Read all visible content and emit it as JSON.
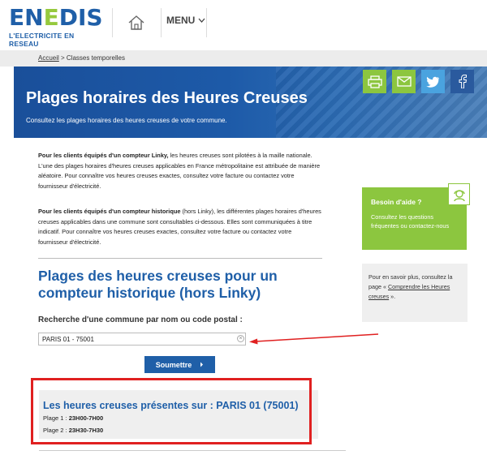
{
  "header": {
    "logo_word_a": "EN",
    "logo_word_b": "E",
    "logo_word_c": "DIS",
    "logo_tagline": "L'ELECTRICITE EN RESEAU",
    "menu_label": "MENU"
  },
  "breadcrumb": {
    "home": "Accueil",
    "separator": " > ",
    "current": "Classes temporelles"
  },
  "hero": {
    "title": "Plages horaires des Heures Creuses",
    "subtitle": "Consultez les plages horaires des heures creuses de votre commune."
  },
  "share": {
    "icons": [
      "printer-icon",
      "mail-icon",
      "twitter-icon",
      "facebook-icon"
    ]
  },
  "intro": {
    "p1_bold": "Pour les clients équipés d'un compteur Linky,",
    "p1_text": " les heures creuses sont pilotées à la maille nationale. L'une des plages horaires d'heures creuses applicables en France métropolitaine est attribuée de manière aléatoire. Pour connaître vos heures creuses exactes, consultez votre facture ou contactez votre fournisseur d'électricité.",
    "p2_bold": "Pour les clients équipés d'un compteur historique",
    "p2_text": " (hors Linky), les différentes plages horaires d'heures creuses applicables dans une commune sont consultables ci-dessous. Elles sont communiquées à titre indicatif. Pour connaître vos heures creuses exactes, consultez votre facture ou contactez votre fournisseur d'électricité."
  },
  "search": {
    "section_title": "Plages des heures creuses pour un compteur historique (hors Linky)",
    "label": "Recherche d'une commune par nom ou code postal :",
    "value": "PARIS 01 - 75001",
    "submit_label": "Soumettre"
  },
  "result": {
    "title": "Les heures creuses présentes sur : PARIS 01 (75001)",
    "ranges": [
      {
        "label": "Plage 1 : ",
        "value": "23H00-7H00"
      },
      {
        "label": "Plage 2 : ",
        "value": "23H30-7H30"
      }
    ]
  },
  "sidebar": {
    "help_title": "Besoin d'aide ?",
    "help_text": "Consultez les questions fréquentes ou contactez-nous",
    "info_text_before": "Pour en savoir plus, consultez la page « ",
    "info_link": "Comprendre les Heures creuses",
    "info_text_after": " »."
  },
  "colors": {
    "brand_blue": "#1f5fa8",
    "brand_green": "#8cc63f",
    "highlight_red": "#e02020"
  }
}
